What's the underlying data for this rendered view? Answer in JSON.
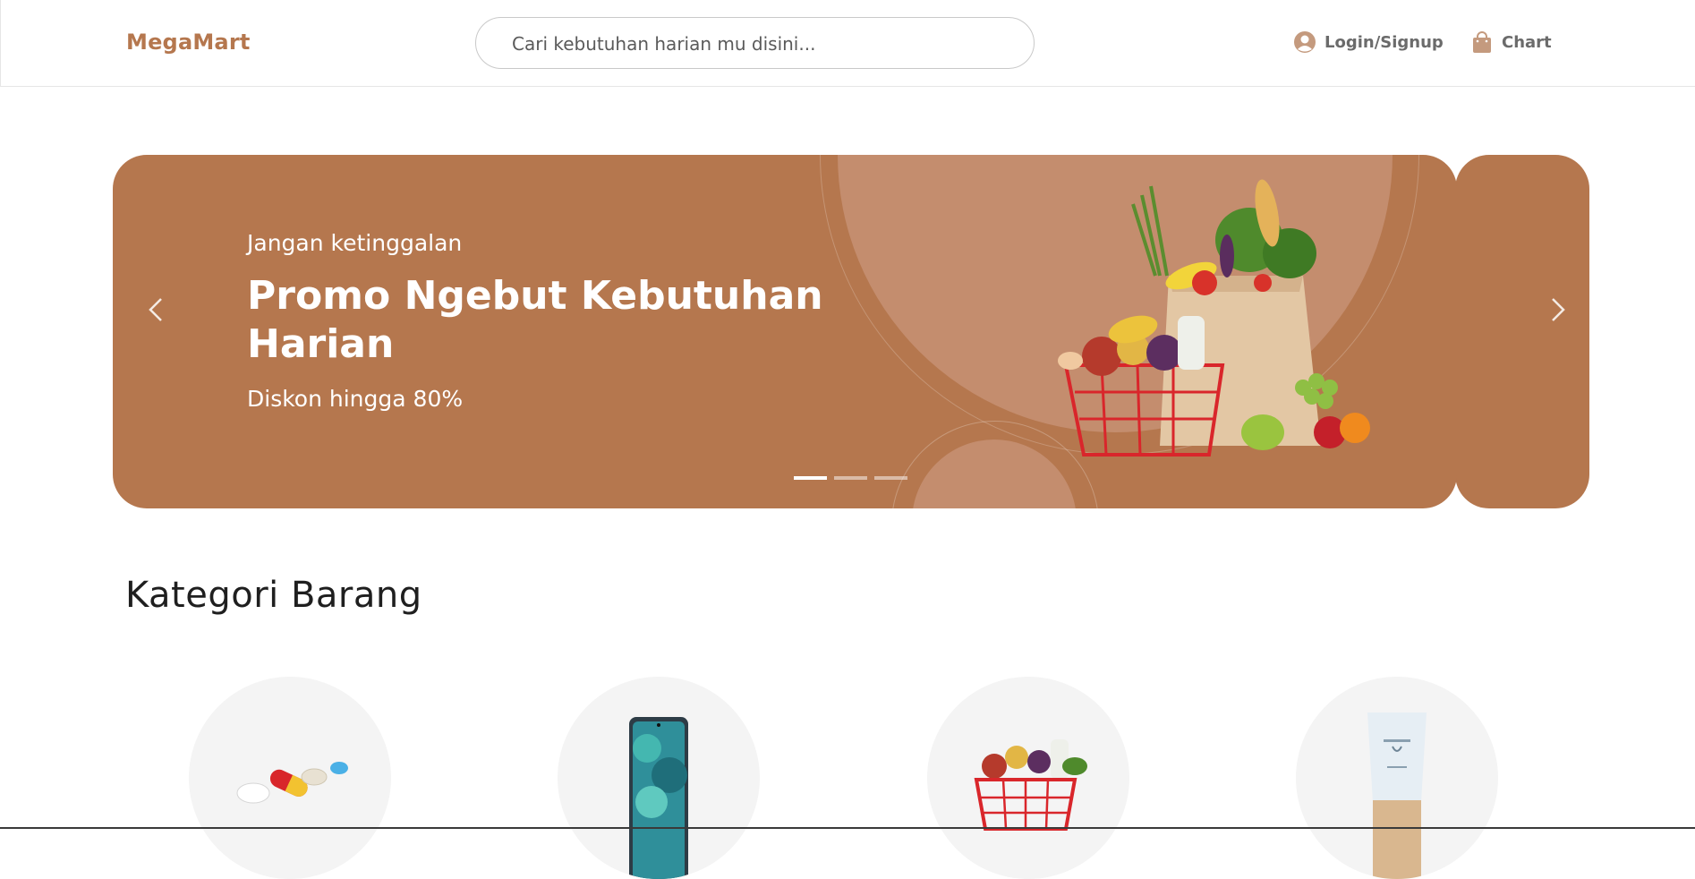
{
  "header": {
    "brand": "MegaMart",
    "search_placeholder": "Cari kebutuhan harian mu disini...",
    "login_label": "Login/Signup",
    "cart_label": "Chart"
  },
  "banner": {
    "subtitle": "Jangan ketinggalan",
    "title": "Promo Ngebut Kebutuhan Harian",
    "description": "Diskon hingga 80%",
    "active_slide": 1,
    "slide_count": 3
  },
  "categories": {
    "title": "Kategori Barang",
    "items": [
      {
        "icon": "pills-icon"
      },
      {
        "icon": "smartphone-icon"
      },
      {
        "icon": "grocery-basket-icon"
      },
      {
        "icon": "skincare-tube-icon"
      }
    ]
  },
  "colors": {
    "accent": "#b5774e",
    "accent_light": "#c48d6e",
    "category_bg": "#f4f4f4"
  }
}
